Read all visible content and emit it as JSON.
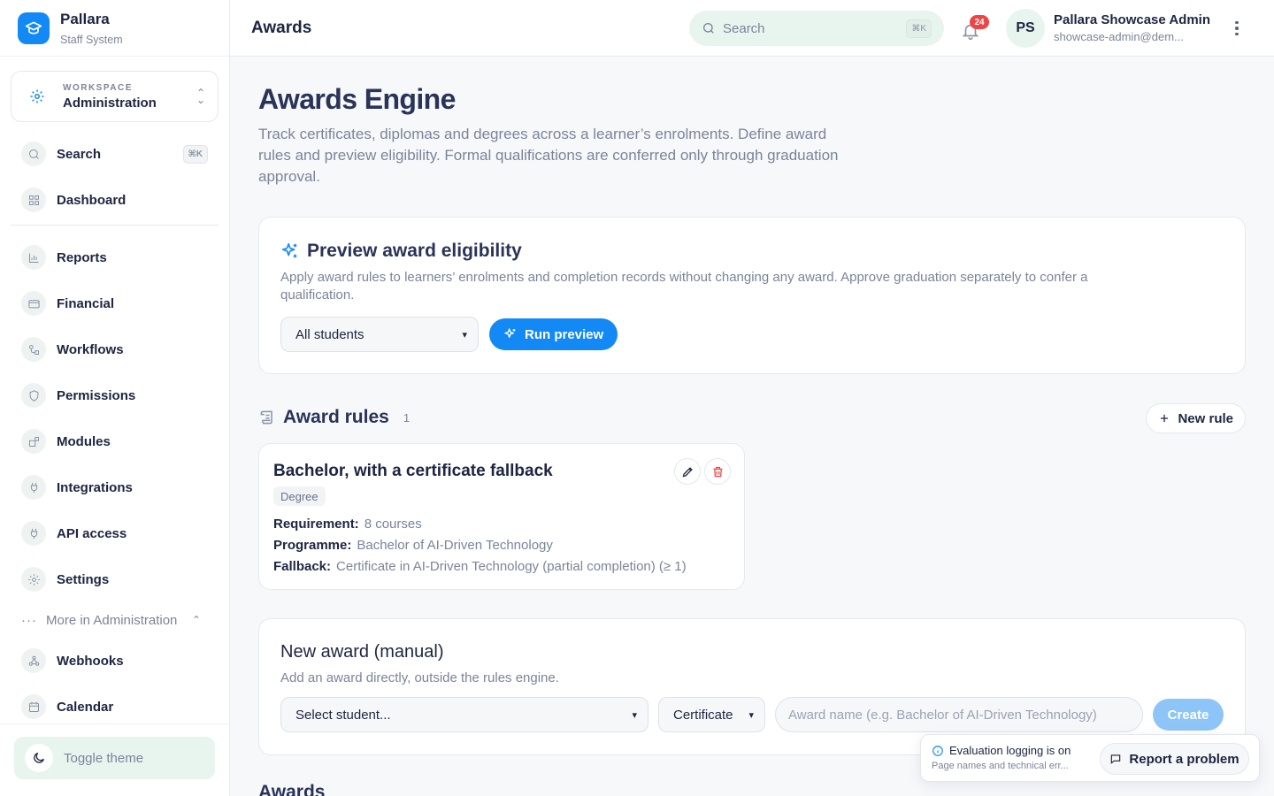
{
  "brand": {
    "name": "Pallara",
    "subtitle": "Staff System"
  },
  "workspace": {
    "label": "WORKSPACE",
    "value": "Administration"
  },
  "sidebar": {
    "items": [
      {
        "label": "Search",
        "shortcut": "⌘K",
        "icon": "search-icon"
      },
      {
        "label": "Dashboard",
        "icon": "grid-icon"
      },
      {
        "label": "Reports",
        "icon": "bar-chart-icon"
      },
      {
        "label": "Financial",
        "icon": "credit-card-icon"
      },
      {
        "label": "Workflows",
        "icon": "workflow-icon"
      },
      {
        "label": "Permissions",
        "icon": "shield-icon"
      },
      {
        "label": "Modules",
        "icon": "modules-icon"
      },
      {
        "label": "Integrations",
        "icon": "plug-icon"
      },
      {
        "label": "API access",
        "icon": "plug-icon"
      },
      {
        "label": "Settings",
        "icon": "gear-icon"
      }
    ],
    "more_label": "More in Administration",
    "more_items": [
      {
        "label": "Webhooks",
        "icon": "webhook-icon"
      },
      {
        "label": "Calendar",
        "icon": "calendar-icon"
      }
    ],
    "toggle_theme": "Toggle theme"
  },
  "header": {
    "title": "Awards",
    "search_placeholder": "Search",
    "search_shortcut": "⌘K",
    "notification_count": "24",
    "avatar_initials": "PS",
    "user_name": "Pallara Showcase Admin",
    "user_email": "showcase-admin@dem..."
  },
  "main": {
    "title": "Awards Engine",
    "description": "Track certificates, diplomas and degrees across a learner’s enrolments. Define award rules and preview eligibility. Formal qualifications are conferred only through graduation approval.",
    "preview": {
      "title": "Preview award eligibility",
      "description": "Apply award rules to learners’ enrolments and completion records without changing any award. Approve graduation separately to confer a qualification.",
      "student_select": "All students",
      "run_button": "Run preview"
    },
    "rules": {
      "title": "Award rules",
      "count": "1",
      "new_rule_button": "New rule",
      "items": [
        {
          "title": "Bachelor, with a certificate fallback",
          "badge": "Degree",
          "requirement_label": "Requirement:",
          "requirement_value": "8 courses",
          "programme_label": "Programme:",
          "programme_value": "Bachelor of AI-Driven Technology",
          "fallback_label": "Fallback:",
          "fallback_value": "Certificate in AI-Driven Technology (partial completion) (≥ 1)"
        }
      ]
    },
    "manual": {
      "title": "New award (manual)",
      "description": "Add an award directly, outside the rules engine.",
      "student_select": "Select student...",
      "type_select": "Certificate",
      "name_placeholder": "Award name (e.g. Bachelor of AI-Driven Technology)",
      "create_button": "Create"
    },
    "awards_heading": "Awards"
  },
  "toast": {
    "title": "Evaluation logging is on",
    "subtitle": "Page names and technical err...",
    "button": "Report a problem"
  },
  "colors": {
    "primary": "#1389f5",
    "accent_bg": "#e8f5ef",
    "danger": "#ef4444"
  }
}
